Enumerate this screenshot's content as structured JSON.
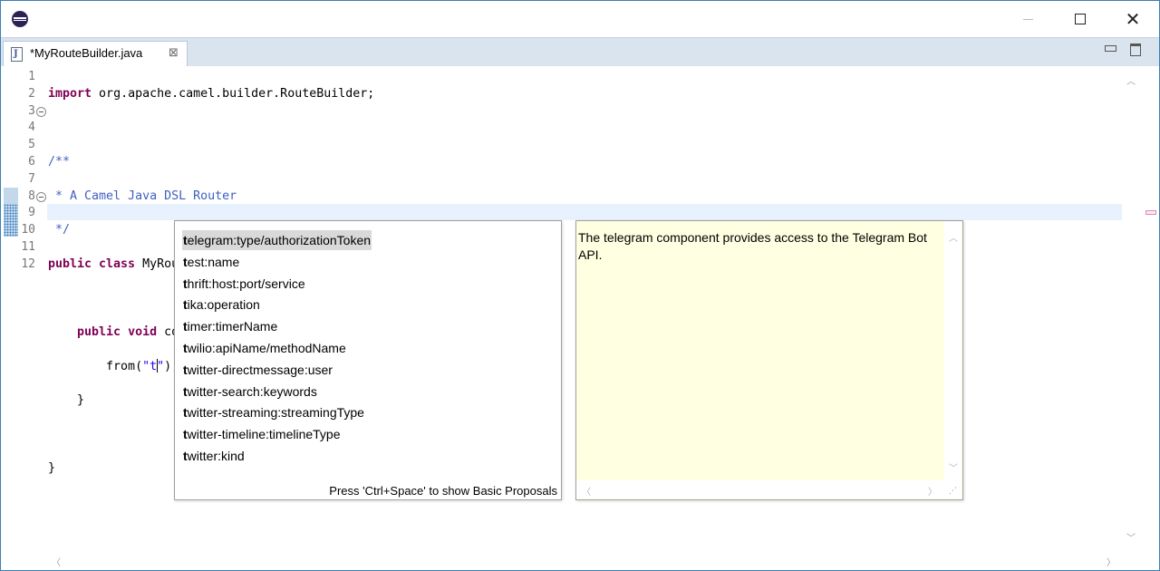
{
  "window": {
    "controls": {
      "minimize": "minimize-icon",
      "maximize": "maximize-icon",
      "close": "✕"
    }
  },
  "tab": {
    "label": "*MyRouteBuilder.java",
    "close": "⊠",
    "icon_glyph": "J"
  },
  "editor": {
    "line_numbers": [
      "1",
      "2",
      "3",
      "4",
      "5",
      "6",
      "7",
      "8",
      "9",
      "10",
      "11",
      "12"
    ]
  },
  "completion": {
    "proposals": [
      {
        "prefix": "t",
        "rest": "elegram:type/authorizationToken"
      },
      {
        "prefix": "t",
        "rest": "est:name"
      },
      {
        "prefix": "t",
        "rest": "hrift:host:port/service"
      },
      {
        "prefix": "t",
        "rest": "ika:operation"
      },
      {
        "prefix": "t",
        "rest": "imer:timerName"
      },
      {
        "prefix": "t",
        "rest": "wilio:apiName/methodName"
      },
      {
        "prefix": "t",
        "rest": "witter-directmessage:user"
      },
      {
        "prefix": "t",
        "rest": "witter-search:keywords"
      },
      {
        "prefix": "t",
        "rest": "witter-streaming:streamingType"
      },
      {
        "prefix": "t",
        "rest": "witter-timeline:timelineType"
      },
      {
        "prefix": "t",
        "rest": "witter:kind"
      }
    ],
    "footer": "Press 'Ctrl+Space' to show Basic Proposals",
    "doc": "The telegram component provides access to the Telegram Bot API."
  },
  "colors": {
    "keyword": "#7f0055",
    "comment": "#3f5fbf",
    "string": "#2a00ff",
    "tab_bar": "#dae4ee",
    "doc_background": "#ffffe1",
    "current_line": "#e8f2fe"
  }
}
